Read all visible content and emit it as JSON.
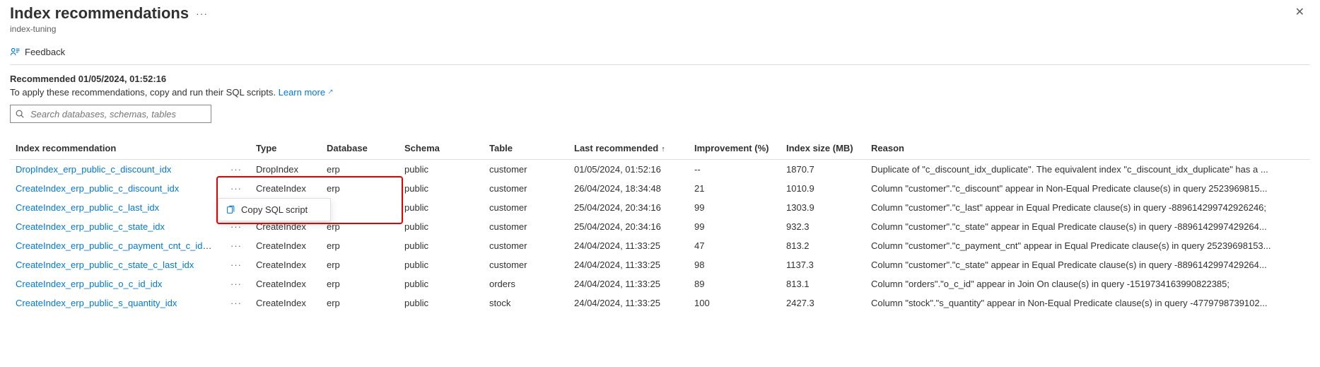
{
  "header": {
    "title": "Index recommendations",
    "subtitle": "index-tuning",
    "more_icon": "more-horizontal-icon",
    "close_icon": "close-icon",
    "close_glyph": "✕"
  },
  "feedback": {
    "label": "Feedback",
    "icon": "feedback-icon"
  },
  "summary": {
    "line1": "Recommended 01/05/2024, 01:52:16",
    "line2": "To apply these recommendations, copy and run their SQL scripts.",
    "learn_more_label": "Learn more",
    "ext_glyph": "🡕"
  },
  "search": {
    "placeholder": "Search databases, schemas, tables",
    "icon": "search-icon"
  },
  "contextmenu": {
    "visible": true,
    "anchored_row": 1,
    "items": [
      {
        "label": "Copy SQL script",
        "icon": "copy-icon"
      }
    ]
  },
  "highlight": {
    "visible": true,
    "desc": "Red rectangle around row-2 more button, context menu, and Type/Database cells"
  },
  "table": {
    "columns": [
      {
        "key": "rec",
        "label": "Index recommendation"
      },
      {
        "key": "type",
        "label": "Type"
      },
      {
        "key": "db",
        "label": "Database"
      },
      {
        "key": "schema",
        "label": "Schema"
      },
      {
        "key": "table",
        "label": "Table"
      },
      {
        "key": "last",
        "label": "Last recommended",
        "sorted": "asc"
      },
      {
        "key": "impr",
        "label": "Improvement (%)"
      },
      {
        "key": "size",
        "label": "Index size (MB)"
      },
      {
        "key": "reason",
        "label": "Reason"
      }
    ],
    "rows": [
      {
        "rec": "DropIndex_erp_public_c_discount_idx",
        "type": "DropIndex",
        "db": "erp",
        "schema": "public",
        "table": "customer",
        "last": "01/05/2024, 01:52:16",
        "impr": "--",
        "size": "1870.7",
        "reason": "Duplicate of \"c_discount_idx_duplicate\". The equivalent index \"c_discount_idx_duplicate\" has a ..."
      },
      {
        "rec": "CreateIndex_erp_public_c_discount_idx",
        "type": "CreateIndex",
        "db": "erp",
        "schema": "public",
        "table": "customer",
        "last": "26/04/2024, 18:34:48",
        "impr": "21",
        "size": "1010.9",
        "reason": "Column \"customer\".\"c_discount\" appear in Non-Equal Predicate clause(s) in query 2523969815..."
      },
      {
        "rec": "CreateIndex_erp_public_c_last_idx",
        "type": "",
        "db": "",
        "schema": "public",
        "table": "customer",
        "last": "25/04/2024, 20:34:16",
        "impr": "99",
        "size": "1303.9",
        "reason": "Column \"customer\".\"c_last\" appear in Equal Predicate clause(s) in query -889614299742926246;"
      },
      {
        "rec": "CreateIndex_erp_public_c_state_idx",
        "type": "CreateIndex",
        "db": "erp",
        "schema": "public",
        "table": "customer",
        "last": "25/04/2024, 20:34:16",
        "impr": "99",
        "size": "932.3",
        "reason": "Column \"customer\".\"c_state\" appear in Equal Predicate clause(s) in query -8896142997429264..."
      },
      {
        "rec": "CreateIndex_erp_public_c_payment_cnt_c_id_idx",
        "type": "CreateIndex",
        "db": "erp",
        "schema": "public",
        "table": "customer",
        "last": "24/04/2024, 11:33:25",
        "impr": "47",
        "size": "813.2",
        "reason": "Column \"customer\".\"c_payment_cnt\" appear in Equal Predicate clause(s) in query 25239698153..."
      },
      {
        "rec": "CreateIndex_erp_public_c_state_c_last_idx",
        "type": "CreateIndex",
        "db": "erp",
        "schema": "public",
        "table": "customer",
        "last": "24/04/2024, 11:33:25",
        "impr": "98",
        "size": "1137.3",
        "reason": "Column \"customer\".\"c_state\" appear in Equal Predicate clause(s) in query -8896142997429264..."
      },
      {
        "rec": "CreateIndex_erp_public_o_c_id_idx",
        "type": "CreateIndex",
        "db": "erp",
        "schema": "public",
        "table": "orders",
        "last": "24/04/2024, 11:33:25",
        "impr": "89",
        "size": "813.1",
        "reason": "Column \"orders\".\"o_c_id\" appear in Join On clause(s) in query -1519734163990822385;"
      },
      {
        "rec": "CreateIndex_erp_public_s_quantity_idx",
        "type": "CreateIndex",
        "db": "erp",
        "schema": "public",
        "table": "stock",
        "last": "24/04/2024, 11:33:25",
        "impr": "100",
        "size": "2427.3",
        "reason": "Column \"stock\".\"s_quantity\" appear in Non-Equal Predicate clause(s) in query -4779798739102..."
      }
    ]
  }
}
